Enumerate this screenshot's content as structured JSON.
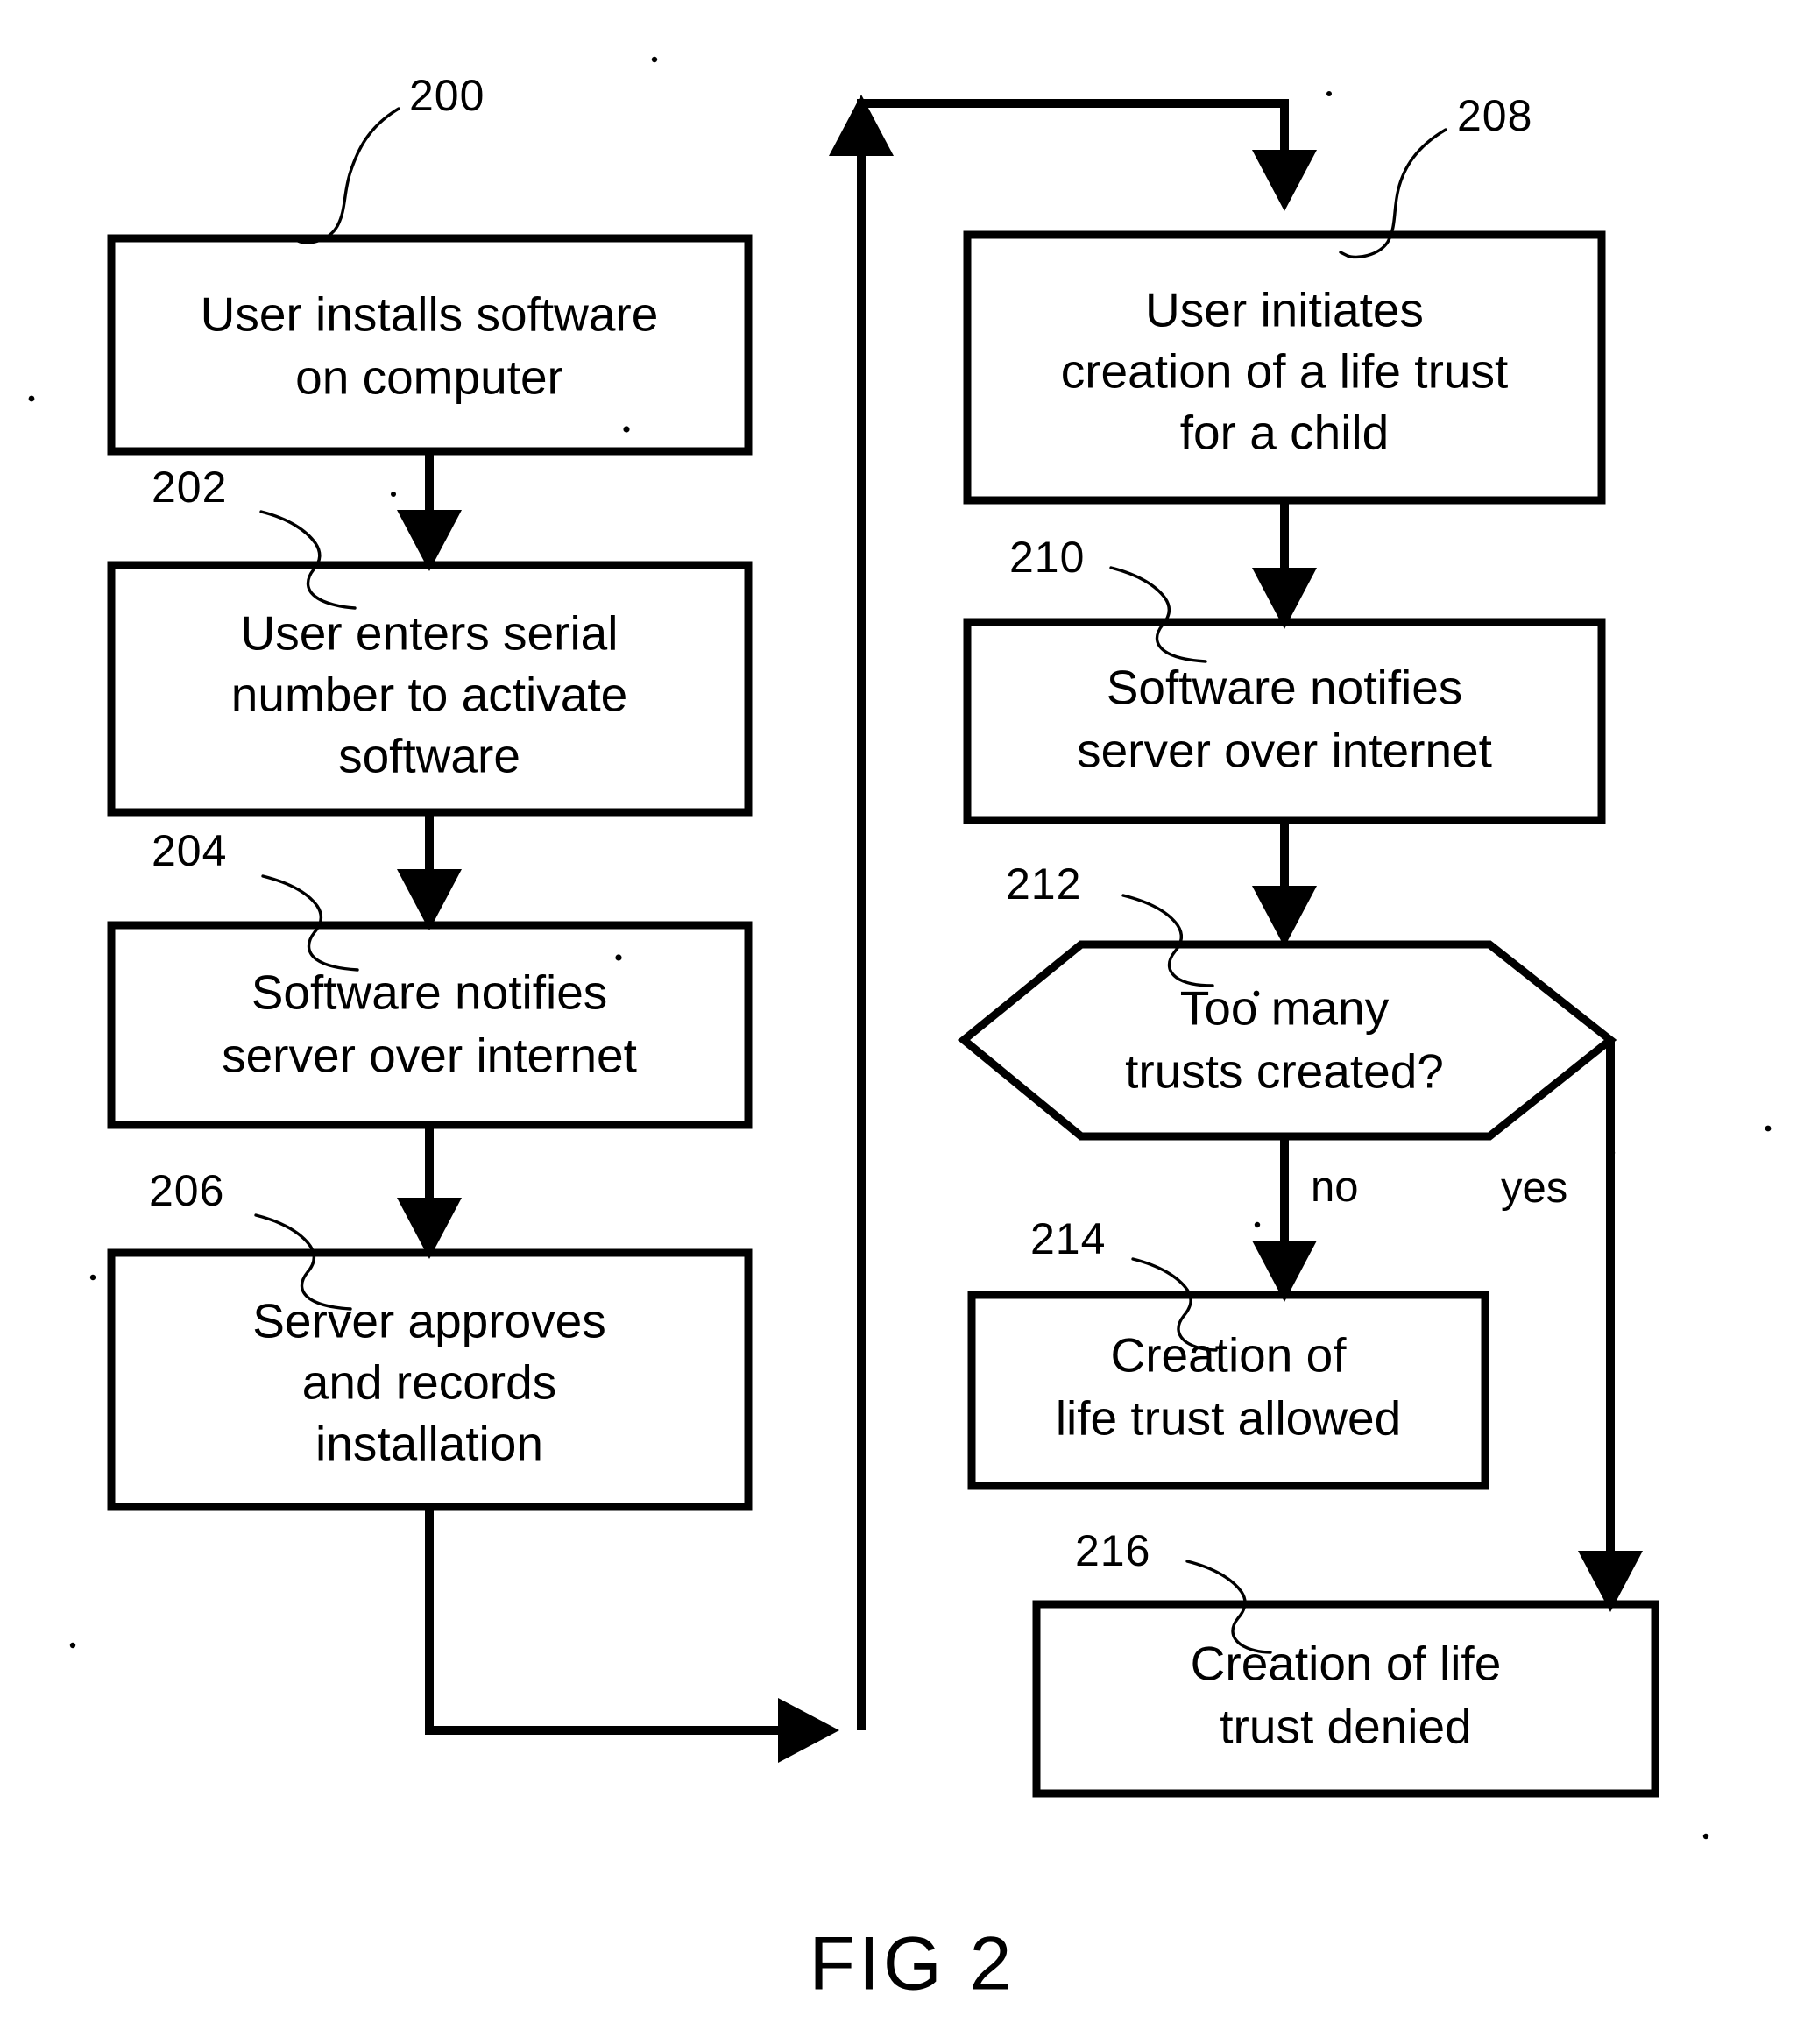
{
  "figure": {
    "caption": "FIG 2",
    "title": "FIG 2"
  },
  "nodes": {
    "n200": {
      "ref": "200",
      "shape": "process",
      "lines": [
        "User installs software",
        "on computer"
      ]
    },
    "n202": {
      "ref": "202",
      "shape": "process",
      "lines": [
        "User enters serial",
        "number to activate",
        "software"
      ]
    },
    "n204": {
      "ref": "204",
      "shape": "process",
      "lines": [
        "Software notifies",
        "server over internet"
      ]
    },
    "n206": {
      "ref": "206",
      "shape": "process",
      "lines": [
        "Server approves",
        "and records",
        "installation"
      ]
    },
    "n208": {
      "ref": "208",
      "shape": "process",
      "lines": [
        "User initiates",
        "creation of a life trust",
        "for a child"
      ]
    },
    "n210": {
      "ref": "210",
      "shape": "process",
      "lines": [
        "Software notifies",
        "server over internet"
      ]
    },
    "n212": {
      "ref": "212",
      "shape": "decision",
      "lines": [
        "Too many",
        "trusts created?"
      ]
    },
    "n214": {
      "ref": "214",
      "shape": "process",
      "lines": [
        "Creation of",
        "life trust allowed"
      ]
    },
    "n216": {
      "ref": "216",
      "shape": "process",
      "lines": [
        "Creation of life",
        "trust denied"
      ]
    }
  },
  "edge_labels": {
    "no": "no",
    "yes": "yes"
  },
  "colors": {
    "ink": "#000000",
    "paper": "#ffffff"
  }
}
